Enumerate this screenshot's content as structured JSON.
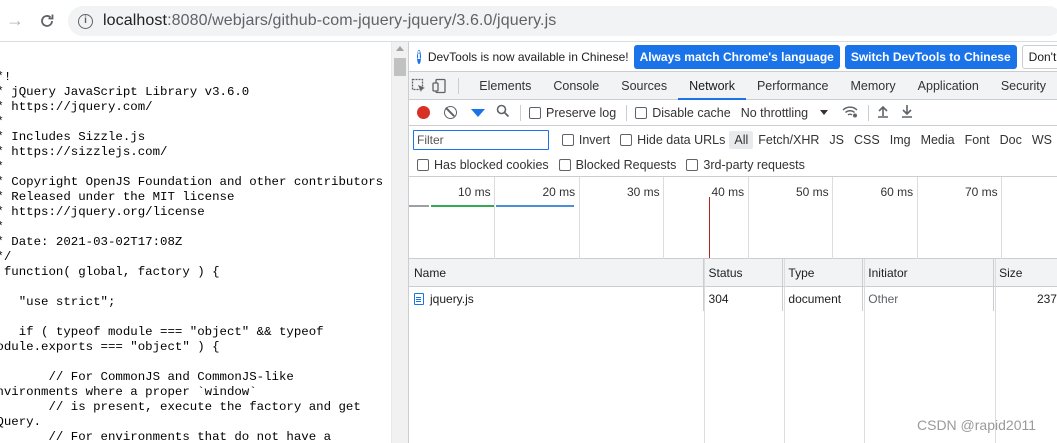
{
  "browser": {
    "url_host": "localhost",
    "url_rest": ":8080/webjars/github-com-jquery-jquery/3.6.0/jquery.js"
  },
  "source_lines": [
    "/*!",
    " * jQuery JavaScript Library v3.6.0",
    " * https://jquery.com/",
    " *",
    " * Includes Sizzle.js",
    " * https://sizzlejs.com/",
    " *",
    " * Copyright OpenJS Foundation and other contributors",
    " * Released under the MIT license",
    " * https://jquery.org/license",
    " *",
    " * Date: 2021-03-02T17:08Z",
    " */",
    "( function( global, factory ) {",
    "",
    "\t\"use strict\";",
    "",
    "\tif ( typeof module === \"object\" && typeof",
    "module.exports === \"object\" ) {",
    "",
    "\t\t// For CommonJS and CommonJS-like",
    "environments where a proper `window`",
    "\t\t// is present, execute the factory and get",
    "jQuery.",
    "\t\t// For environments that do not have a",
    "`window` with a `document`"
  ],
  "devtools": {
    "infobar": {
      "message": "DevTools is now available in Chinese!",
      "match_button": "Always match Chrome's language",
      "switch_button": "Switch DevTools to Chinese",
      "dismiss_button": "Don't show"
    },
    "tabs": [
      "Elements",
      "Console",
      "Sources",
      "Network",
      "Performance",
      "Memory",
      "Application",
      "Security"
    ],
    "active_tab": "Network",
    "toolbar": {
      "preserve_log": "Preserve log",
      "disable_cache": "Disable cache",
      "throttling": "No throttling"
    },
    "filter": {
      "placeholder": "Filter",
      "invert": "Invert",
      "hide_data_urls": "Hide data URLs",
      "types": [
        "All",
        "Fetch/XHR",
        "JS",
        "CSS",
        "Img",
        "Media",
        "Font",
        "Doc",
        "WS"
      ],
      "selected_type": "All",
      "has_blocked_cookies": "Has blocked cookies",
      "blocked_requests": "Blocked Requests",
      "third_party": "3rd-party requests"
    },
    "timeline": {
      "ticks": [
        "10 ms",
        "20 ms",
        "30 ms",
        "40 ms",
        "50 ms",
        "60 ms",
        "70 ms",
        "8"
      ],
      "colors": {
        "waiting": "#9aa0a6",
        "green": "#34a853",
        "blue": "#4a90d9",
        "load_line": "#b3261e"
      }
    },
    "table": {
      "columns": [
        "Name",
        "Status",
        "Type",
        "Initiator",
        "Size"
      ],
      "rows": [
        {
          "name": "jquery.js",
          "status": "304",
          "type": "document",
          "initiator": "Other",
          "size": "237"
        }
      ]
    }
  },
  "watermark": "CSDN @rapid2011"
}
